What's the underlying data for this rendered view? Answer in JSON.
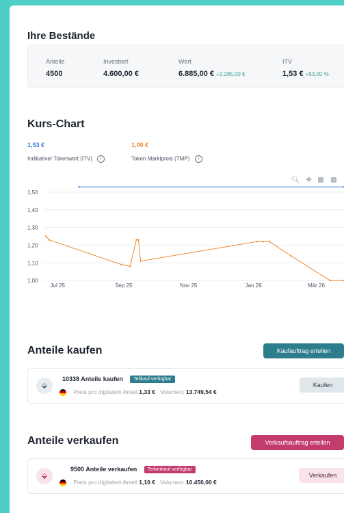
{
  "holdings": {
    "title": "Ihre Bestände",
    "shares_label": "Anteile",
    "shares_value": "4500",
    "invested_label": "Investiert",
    "invested_value": "4.600,00 €",
    "worth_label": "Wert",
    "worth_value": "6.885,00 €",
    "worth_change": "+2.285,00 €",
    "itv_label": "ITV",
    "itv_value": "1,53 €",
    "itv_change": "+53,00 %"
  },
  "kurs": {
    "title": "Kurs-Chart",
    "itv_value": "1,53 €",
    "itv_label": "Indikativer Tokenwert (ITV)",
    "itv_color": "#3b7dd8",
    "tmp_value": "1,00 €",
    "tmp_label": "Token Marktpreis (TMP)",
    "tmp_color": "#f28a2e",
    "tools": [
      "zoom-in-icon",
      "pan-icon",
      "zoom-in-square-icon",
      "zoom-out-square-icon"
    ]
  },
  "chart_data": {
    "type": "line",
    "y_ticks": [
      "1,50",
      "1,40",
      "1,30",
      "1,20",
      "1,10",
      "1,00"
    ],
    "ylim": [
      0.95,
      1.55
    ],
    "x_ticks": [
      {
        "label": "Jul 25",
        "date": "2025-07-01"
      },
      {
        "label": "Sep 25",
        "date": "2025-09-01"
      },
      {
        "label": "Nov 25",
        "date": "2025-11-01"
      },
      {
        "label": "Jan 26",
        "date": "2026-01-01"
      },
      {
        "label": "Mär 26",
        "date": "2026-03-01"
      }
    ],
    "xlim": [
      "2025-06-18",
      "2026-03-27"
    ],
    "grid": true,
    "series": [
      {
        "color": "#3b7dd8",
        "points": [
          [
            "2025-07-21",
            1.53
          ],
          [
            "2026-03-27",
            1.53
          ]
        ]
      },
      {
        "color": "#f28a2e",
        "points": [
          [
            "2025-06-20",
            1.25
          ],
          [
            "2025-06-23",
            1.23
          ],
          [
            "2025-08-30",
            1.09
          ],
          [
            "2025-09-07",
            1.08
          ],
          [
            "2025-09-13",
            1.23
          ],
          [
            "2025-09-15",
            1.23
          ],
          [
            "2025-09-17",
            1.11
          ],
          [
            "2026-01-04",
            1.22
          ],
          [
            "2026-01-10",
            1.22
          ],
          [
            "2026-01-16",
            1.22
          ],
          [
            "2026-02-05",
            1.14
          ],
          [
            "2026-03-14",
            1.0
          ],
          [
            "2026-03-27",
            1.0
          ]
        ]
      }
    ]
  },
  "buy": {
    "title": "Anteile kaufen",
    "create_label": "Kaufauftrag erteilen",
    "card_title": "10338 Anteile kaufen",
    "badge": "Teilkauf verfügbar",
    "price_label": "Preis pro digitalem Anteil",
    "price_value": "1,33 €",
    "volume_label": "Volumen:",
    "volume_value": "13.749,54 €",
    "action_label": "Kaufen"
  },
  "sell": {
    "title": "Anteile verkaufen",
    "create_label": "Verkaufsauftrag erteilen",
    "card_title": "9500 Anteile verkaufen",
    "badge": "Teilverkauf verfügbar",
    "price_label": "Preis pro digitalem Anteil",
    "price_value": "1,10 €",
    "volume_label": "Volumen:",
    "volume_value": "10.450,00 €",
    "action_label": "Verkaufen"
  }
}
